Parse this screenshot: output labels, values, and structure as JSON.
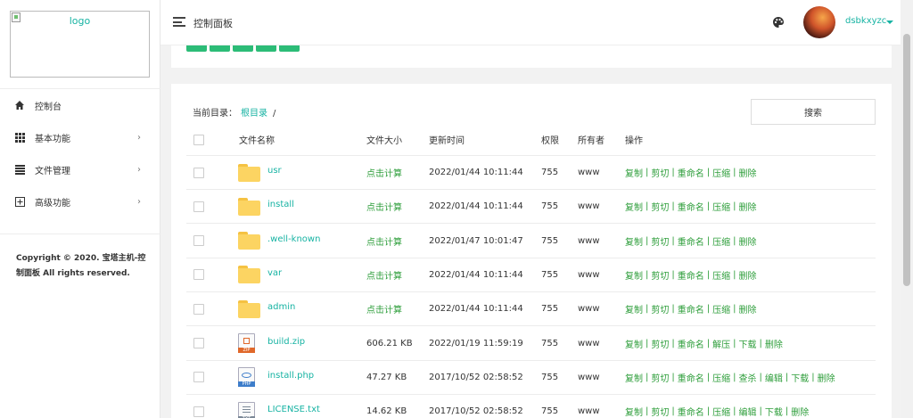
{
  "sidebar": {
    "logo_alt": "logo",
    "items": [
      {
        "label": "控制台",
        "icon": "home-icon",
        "has_arrow": false
      },
      {
        "label": "基本功能",
        "icon": "grid-icon",
        "has_arrow": true
      },
      {
        "label": "文件管理",
        "icon": "list-icon",
        "has_arrow": true
      },
      {
        "label": "高级功能",
        "icon": "plus-square-icon",
        "has_arrow": true
      }
    ],
    "copyright": "Copyright © 2020. 宝塔主机-控制面板 All rights reserved."
  },
  "header": {
    "title": "控制面板",
    "username": "dsbkxyzc"
  },
  "filemanager": {
    "breadcrumb_label": "当前目录：",
    "breadcrumb_root": "根目录",
    "breadcrumb_sep": "/",
    "search_label": "搜索",
    "columns": {
      "name": "文件名称",
      "size": "文件大小",
      "time": "更新时间",
      "perm": "权限",
      "owner": "所有者",
      "ops": "操作"
    },
    "rows": [
      {
        "name": "usr",
        "type": "folder",
        "size": "点击计算",
        "time": "2022/01/44 10:11:44",
        "perm": "755",
        "owner": "www",
        "ops": [
          "复制",
          "剪切",
          "重命名",
          "压缩",
          "删除"
        ]
      },
      {
        "name": "install",
        "type": "folder",
        "size": "点击计算",
        "time": "2022/01/44 10:11:44",
        "perm": "755",
        "owner": "www",
        "ops": [
          "复制",
          "剪切",
          "重命名",
          "压缩",
          "删除"
        ]
      },
      {
        "name": ".well-known",
        "type": "folder",
        "size": "点击计算",
        "time": "2022/01/47 10:01:47",
        "perm": "755",
        "owner": "www",
        "ops": [
          "复制",
          "剪切",
          "重命名",
          "压缩",
          "删除"
        ]
      },
      {
        "name": "var",
        "type": "folder",
        "size": "点击计算",
        "time": "2022/01/44 10:11:44",
        "perm": "755",
        "owner": "www",
        "ops": [
          "复制",
          "剪切",
          "重命名",
          "压缩",
          "删除"
        ]
      },
      {
        "name": "admin",
        "type": "folder",
        "size": "点击计算",
        "time": "2022/01/44 10:11:44",
        "perm": "755",
        "owner": "www",
        "ops": [
          "复制",
          "剪切",
          "重命名",
          "压缩",
          "删除"
        ]
      },
      {
        "name": "build.zip",
        "type": "zip",
        "size": "606.21 KB",
        "time": "2022/01/19 11:59:19",
        "perm": "755",
        "owner": "www",
        "ops": [
          "复制",
          "剪切",
          "重命名",
          "解压",
          "下载",
          "删除"
        ]
      },
      {
        "name": "install.php",
        "type": "php",
        "size": "47.27 KB",
        "time": "2017/10/52 02:58:52",
        "perm": "755",
        "owner": "www",
        "ops": [
          "复制",
          "剪切",
          "重命名",
          "压缩",
          "查杀",
          "编辑",
          "下载",
          "删除"
        ]
      },
      {
        "name": "LICENSE.txt",
        "type": "txt",
        "size": "14.62 KB",
        "time": "2017/10/52 02:58:52",
        "perm": "755",
        "owner": "www",
        "ops": [
          "复制",
          "剪切",
          "重命名",
          "压缩",
          "编辑",
          "下载",
          "删除"
        ]
      }
    ]
  },
  "colors": {
    "accent": "#17b3a3",
    "action_green": "#2e9e3b",
    "button_green": "#2cbc77"
  }
}
